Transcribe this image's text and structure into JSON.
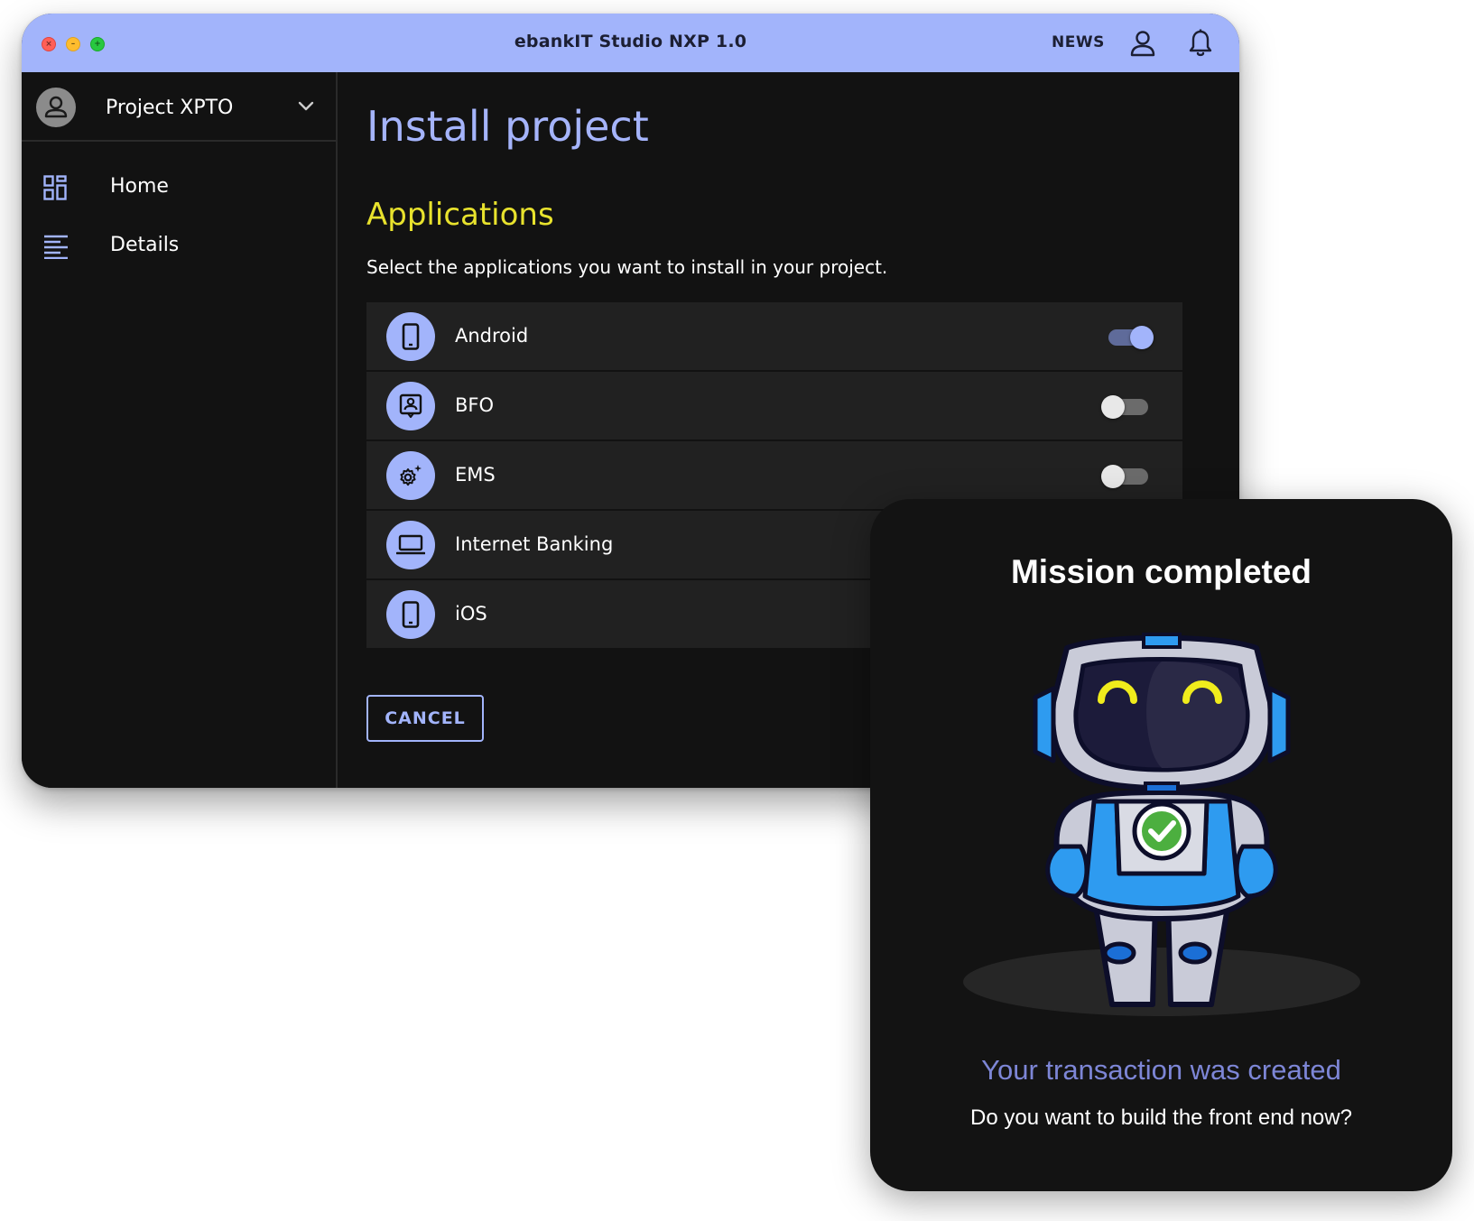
{
  "window": {
    "title": "ebankIT Studio NXP 1.0",
    "news_label": "NEWS",
    "icons": [
      "user-icon",
      "bell-icon"
    ]
  },
  "sidebar": {
    "project": "Project XPTO",
    "items": [
      {
        "label": "Home",
        "icon": "dashboard-icon"
      },
      {
        "label": "Details",
        "icon": "list-icon"
      }
    ]
  },
  "main": {
    "title": "Install project",
    "section": "Applications",
    "description": "Select the applications you want to install in your project.",
    "apps": [
      {
        "name": "Android",
        "icon": "phone-icon",
        "enabled": true
      },
      {
        "name": "BFO",
        "icon": "badge-icon",
        "enabled": false
      },
      {
        "name": "EMS",
        "icon": "settings-sparkle-icon",
        "enabled": false
      },
      {
        "name": "Internet Banking",
        "icon": "laptop-icon",
        "enabled": false
      },
      {
        "name": "iOS",
        "icon": "phone-icon",
        "enabled": false
      }
    ],
    "cancel_label": "CANCEL"
  },
  "dialog": {
    "title": "Mission completed",
    "subtitle": "Your transaction was created",
    "question": "Do you want to build the front end now?"
  },
  "colors": {
    "accent": "#a2b4fb",
    "section_yellow": "#e8e22d",
    "background": "#121212",
    "row": "#212121"
  }
}
